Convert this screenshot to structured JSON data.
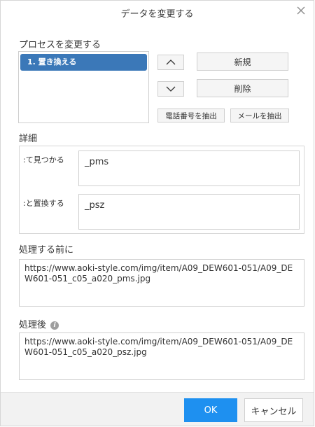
{
  "dialog": {
    "title": "データを変更する",
    "close_icon": "close-icon"
  },
  "process": {
    "heading": "プロセスを変更する",
    "items": [
      {
        "label": "1. 置き換える",
        "selected": true
      }
    ],
    "new_label": "新規",
    "delete_label": "削除",
    "extract_phone_label": "電話番号を抽出",
    "extract_email_label": "メールを抽出",
    "up_icon": "chevron-up-icon",
    "down_icon": "chevron-down-icon"
  },
  "details": {
    "heading": "詳細",
    "find_label": ":て見つかる",
    "find_value": "_pms",
    "replace_label": ":と置換する",
    "replace_value": "_psz"
  },
  "before": {
    "heading": "処理する前に",
    "value": "https://www.aoki-style.com/img/item/A09_DEW601-051/A09_DEW601-051_c05_a020_pms.jpg"
  },
  "after": {
    "heading": "処理後",
    "info_icon": "info-icon",
    "value": "https://www.aoki-style.com/img/item/A09_DEW601-051/A09_DEW601-051_c05_a020_psz.jpg"
  },
  "footer": {
    "ok_label": "OK",
    "cancel_label": "キャンセル"
  },
  "colors": {
    "accent": "#1e90f0",
    "selected_item": "#3b78b8"
  }
}
